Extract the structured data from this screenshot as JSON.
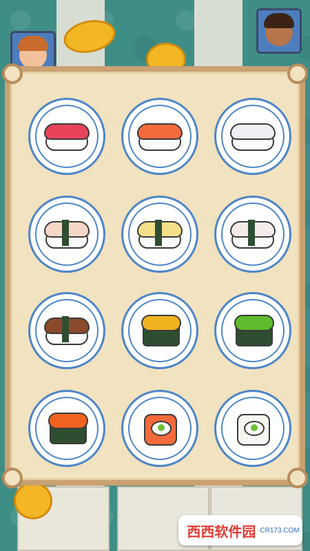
{
  "game": {
    "panel_title": "",
    "plates": [
      {
        "name": "tuna-nigiri",
        "fish_color": "#e8435a"
      },
      {
        "name": "salmon-nigiri",
        "fish_color": "#f46a3c"
      },
      {
        "name": "squid-nigiri",
        "fish_color": "#f2eff4"
      },
      {
        "name": "shrimp-nigiri",
        "fish_color": "#f7d6c8"
      },
      {
        "name": "tamago-nigiri",
        "fish_color": "#f4e08a"
      },
      {
        "name": "flatfish-nigiri",
        "fish_color": "#f4ece8"
      },
      {
        "name": "eel-nigiri",
        "fish_color": "#8c4a2c"
      },
      {
        "name": "sea-urchin-gunkan",
        "fish_color": "#f0b21f"
      },
      {
        "name": "seaweed-gunkan",
        "fish_color": "#5dbb2c"
      },
      {
        "name": "salmon-roe-gunkan",
        "fish_color": "#f0621f"
      },
      {
        "name": "salmon-roll",
        "fish_color": "#f46a3c"
      },
      {
        "name": "california-roll",
        "fish_color": "#fafafa"
      }
    ]
  },
  "watermark": {
    "brand": "西西软件园",
    "sub": "CR173.COM"
  }
}
